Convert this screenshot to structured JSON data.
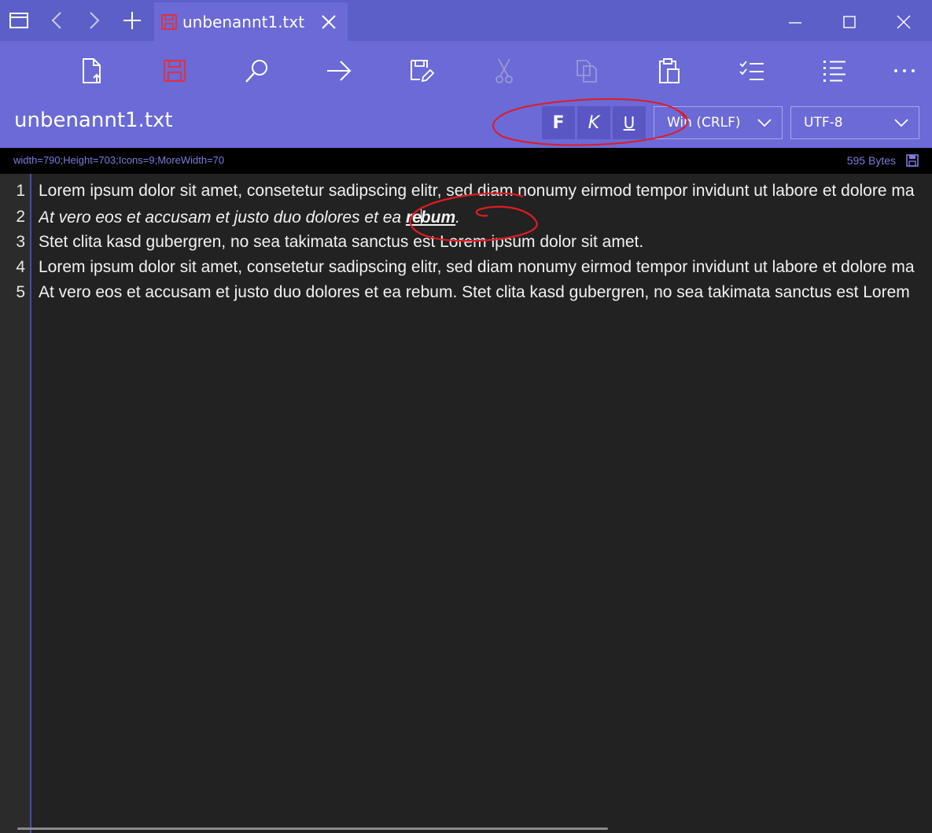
{
  "titlebar": {
    "tab_title": "unbenannt1.txt",
    "icons": [
      "window-icon",
      "back-icon",
      "forward-icon",
      "new-tab-icon",
      "floppy-icon",
      "close-icon",
      "minimize-icon",
      "maximize-icon",
      "window-close-icon"
    ]
  },
  "toolbar": {
    "tools": [
      "new-file-icon",
      "save-icon",
      "search-icon",
      "goto-icon",
      "save-as-icon",
      "cut-icon",
      "copy-icon",
      "paste-icon",
      "checklist-icon",
      "list-icon",
      "more-icon"
    ],
    "filename": "unbenannt1.txt",
    "bold_label": "F",
    "italic_label": "K",
    "underline_label": "U",
    "line_ending": "Win (CRLF)",
    "encoding": "UTF-8"
  },
  "status": {
    "debug_text": "width=790;Height=703;Icons=9;MoreWidth=70",
    "size_text": "595 Bytes"
  },
  "editor": {
    "line_numbers": [
      "1",
      "2",
      "3",
      "4",
      "5"
    ],
    "line1": "Lorem ipsum dolor sit amet, consetetur sadipscing elitr, sed diam nonumy eirmod tempor invidunt ut labore et dolore magna aliquyam erat, sed diam voluptua.",
    "line2_italic": "At vero eos et accusam et justo duo dolores et ea ",
    "line2_bold_a": "re",
    "line2_bold_b": "bum",
    "line2_end": ".",
    "line3": "Stet clita kasd gubergren, no sea takimata sanctus est Lorem ipsum dolor sit amet.",
    "line4": "Lorem ipsum dolor sit amet, consetetur sadipscing elitr, sed diam nonumy eirmod tempor invidunt ut labore et dolore magna aliquyam erat, sed diam voluptua.",
    "line5": "At vero eos et accusam et justo duo dolores et ea rebum. Stet clita kasd gubergren, no sea takimata sanctus est Lorem ipsum dolor sit amet."
  },
  "colors": {
    "titlebar": "#5b5fc7",
    "toolbar": "#6b6ad6",
    "save_icon": "#e0323c",
    "annotation": "#e01b24",
    "editor_bg": "#222222"
  }
}
